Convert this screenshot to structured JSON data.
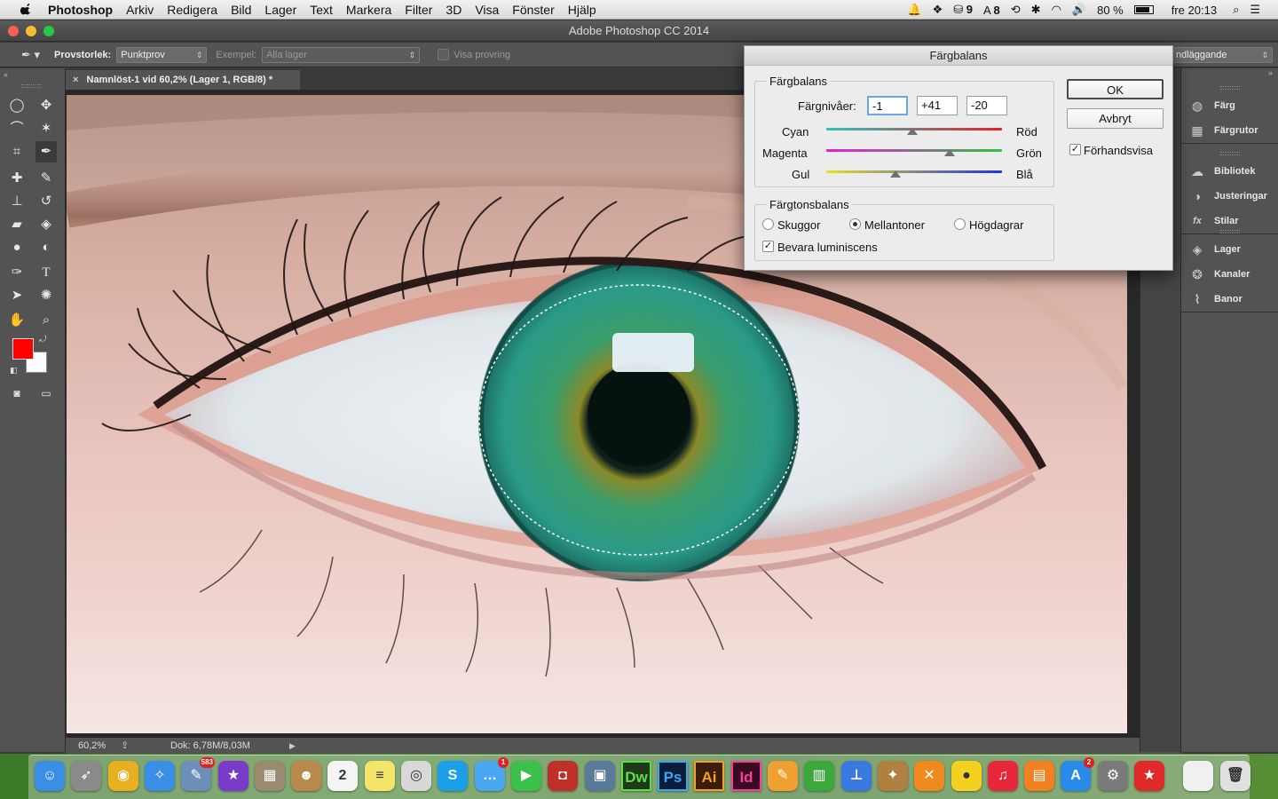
{
  "menubar": {
    "items": [
      "Photoshop",
      "Arkiv",
      "Redigera",
      "Bild",
      "Lager",
      "Text",
      "Markera",
      "Filter",
      "3D",
      "Visa",
      "Fönster",
      "Hjälp"
    ],
    "status": {
      "badge1": "9",
      "badge2": "8",
      "battery": "80 %",
      "clock": "fre 20:13"
    }
  },
  "window": {
    "title": "Adobe Photoshop CC 2014"
  },
  "options": {
    "sample_size_label": "Provstorlek:",
    "sample_size_value": "Punktprov",
    "sample_label": "Exempel:",
    "sample_value": "Alla lager",
    "show_ring_label": "Visa provring",
    "workspace_value": "ndläggande"
  },
  "document": {
    "tab_title": "Namnlöst-1 vid 60,2% (Lager 1, RGB/8) *",
    "zoom": "60,2%",
    "doc_info": "Dok: 6,78M/8,03M"
  },
  "panels": {
    "group1": [
      {
        "label": "Färg",
        "icon": "color-wheel-icon"
      },
      {
        "label": "Färgrutor",
        "icon": "swatches-grid-icon"
      }
    ],
    "group2": [
      {
        "label": "Bibliotek",
        "icon": "cloud-library-icon"
      },
      {
        "label": "Justeringar",
        "icon": "adjust-circle-icon"
      },
      {
        "label": "Stilar",
        "icon": "fx-icon"
      }
    ],
    "group3": [
      {
        "label": "Lager",
        "icon": "layers-icon"
      },
      {
        "label": "Kanaler",
        "icon": "channels-icon"
      },
      {
        "label": "Banor",
        "icon": "paths-icon"
      }
    ]
  },
  "dialog": {
    "title": "Färgbalans",
    "balance_legend": "Färgbalans",
    "levels_label": "Färgnivåer:",
    "levels": [
      "-1",
      "+41",
      "-20"
    ],
    "sliders": [
      {
        "left": "Cyan",
        "right": "Röd",
        "value": -1,
        "from": "#2ec4b6",
        "to": "#e8202a"
      },
      {
        "left": "Magenta",
        "right": "Grön",
        "value": 41,
        "from": "#e020d8",
        "to": "#30c040"
      },
      {
        "left": "Gul",
        "right": "Blå",
        "value": -20,
        "from": "#e8e020",
        "to": "#2030e0"
      }
    ],
    "tone_legend": "Färgtonsbalans",
    "tones": [
      "Skuggor",
      "Mellantoner",
      "Högdagrar"
    ],
    "tone_selected": "Mellantoner",
    "preserve_label": "Bevara luminiscens",
    "preserve_checked": true,
    "ok_label": "OK",
    "cancel_label": "Avbryt",
    "preview_label": "Förhandsvisa",
    "preview_checked": true
  },
  "colors": {
    "foreground": "#ff0000",
    "background": "#ffffff",
    "ui_panel": "#535353"
  },
  "dock": {
    "apps": [
      {
        "name": "finder",
        "icon": "finder-icon",
        "color": "#3a8ee6",
        "glyph": "☺"
      },
      {
        "name": "launchpad",
        "icon": "rocket-icon",
        "color": "#8a8a8a",
        "glyph": "➶"
      },
      {
        "name": "chrome",
        "icon": "chrome-icon",
        "color": "#e8b020",
        "glyph": "◉"
      },
      {
        "name": "safari",
        "icon": "compass-icon",
        "color": "#3a8ee6",
        "glyph": "✧"
      },
      {
        "name": "preview",
        "icon": "preview-icon",
        "color": "#6b8fb8",
        "glyph": "✎",
        "badge": "583"
      },
      {
        "name": "imovie",
        "icon": "star-icon",
        "color": "#7a3cc8",
        "glyph": "★"
      },
      {
        "name": "calculator",
        "icon": "calculator-icon",
        "color": "#9a8a70",
        "glyph": "▦"
      },
      {
        "name": "contacts",
        "icon": "contacts-icon",
        "color": "#b8894a",
        "glyph": "☻"
      },
      {
        "name": "calendar",
        "icon": "calendar-icon",
        "color": "#f4f4f4",
        "glyph": "2"
      },
      {
        "name": "notes",
        "icon": "notes-icon",
        "color": "#f4e46a",
        "glyph": "≡"
      },
      {
        "name": "photo-booth",
        "icon": "photos-icon",
        "color": "#d8d8d8",
        "glyph": "◎"
      },
      {
        "name": "skype",
        "icon": "skype-icon",
        "color": "#1aa0e8",
        "glyph": "S"
      },
      {
        "name": "messages",
        "icon": "messages-icon",
        "color": "#4aa8f0",
        "glyph": "…",
        "badge": "1"
      },
      {
        "name": "facetime",
        "icon": "facetime-icon",
        "color": "#3cc04a",
        "glyph": "▶"
      },
      {
        "name": "photo-booth2",
        "icon": "photobooth-icon",
        "color": "#c0302a",
        "glyph": "◘"
      },
      {
        "name": "image-capture",
        "icon": "camera-icon",
        "color": "#5a7a9a",
        "glyph": "▣"
      },
      {
        "name": "dreamweaver",
        "icon": "dw-icon",
        "color": "#1e3a1a",
        "glyph": "Dw"
      },
      {
        "name": "photoshop",
        "icon": "ps-icon",
        "color": "#0a1e3a",
        "glyph": "Ps"
      },
      {
        "name": "illustrator",
        "icon": "ai-icon",
        "color": "#3a1e0a",
        "glyph": "Ai"
      },
      {
        "name": "indesign",
        "icon": "id-icon",
        "color": "#3a0a22",
        "glyph": "Id"
      },
      {
        "name": "pages",
        "icon": "pages-icon",
        "color": "#f0a030",
        "glyph": "✎"
      },
      {
        "name": "numbers",
        "icon": "numbers-icon",
        "color": "#3aa83a",
        "glyph": "▥"
      },
      {
        "name": "keynote",
        "icon": "keynote-icon",
        "color": "#3a7ae0",
        "glyph": "⊥"
      },
      {
        "name": "game1",
        "icon": "lion-icon",
        "color": "#b08040",
        "glyph": "✦"
      },
      {
        "name": "game2",
        "icon": "x-icon",
        "color": "#f08a20",
        "glyph": "✕"
      },
      {
        "name": "cyberduck",
        "icon": "duck-icon",
        "color": "#f4d020",
        "glyph": "●"
      },
      {
        "name": "itunes",
        "icon": "music-icon",
        "color": "#e8283a",
        "glyph": "♫"
      },
      {
        "name": "ibooks",
        "icon": "book-icon",
        "color": "#f08020",
        "glyph": "▤"
      },
      {
        "name": "app-store",
        "icon": "appstore-icon",
        "color": "#2a8ae8",
        "glyph": "A",
        "badge": "2"
      },
      {
        "name": "system-preferences",
        "icon": "gear-icon",
        "color": "#7a7a7a",
        "glyph": "⚙"
      },
      {
        "name": "bookmark",
        "icon": "bookmark-icon",
        "color": "#e02a2a",
        "glyph": "★"
      },
      {
        "name": "documents",
        "icon": "document-icon",
        "color": "#f0f0f0",
        "glyph": ""
      },
      {
        "name": "trash",
        "icon": "trash-icon",
        "color": "#e0e0e0",
        "glyph": "🗑"
      }
    ]
  }
}
